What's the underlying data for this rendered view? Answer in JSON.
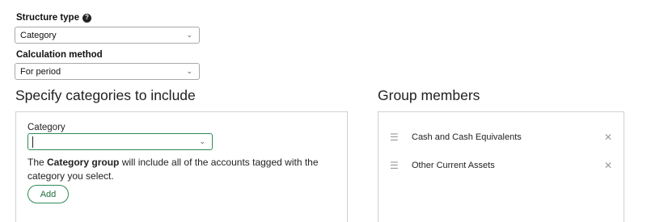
{
  "structure_type": {
    "label": "Structure type",
    "help_icon": "question-circle-icon",
    "value": "Category"
  },
  "calculation_method": {
    "label": "Calculation method",
    "value": "For period"
  },
  "categories_section": {
    "title": "Specify categories to include",
    "category_label": "Category",
    "category_value": "",
    "help_prefix": "The ",
    "help_bold": "Category group",
    "help_suffix": " will include all of the accounts tagged with the category you select.",
    "add_label": "Add"
  },
  "group_members": {
    "title": "Group members",
    "items": [
      {
        "label": "Cash and Cash Equivalents"
      },
      {
        "label": "Other Current Assets"
      }
    ]
  },
  "colors": {
    "accent": "#2e8b57",
    "border": "#d0d0d0"
  }
}
